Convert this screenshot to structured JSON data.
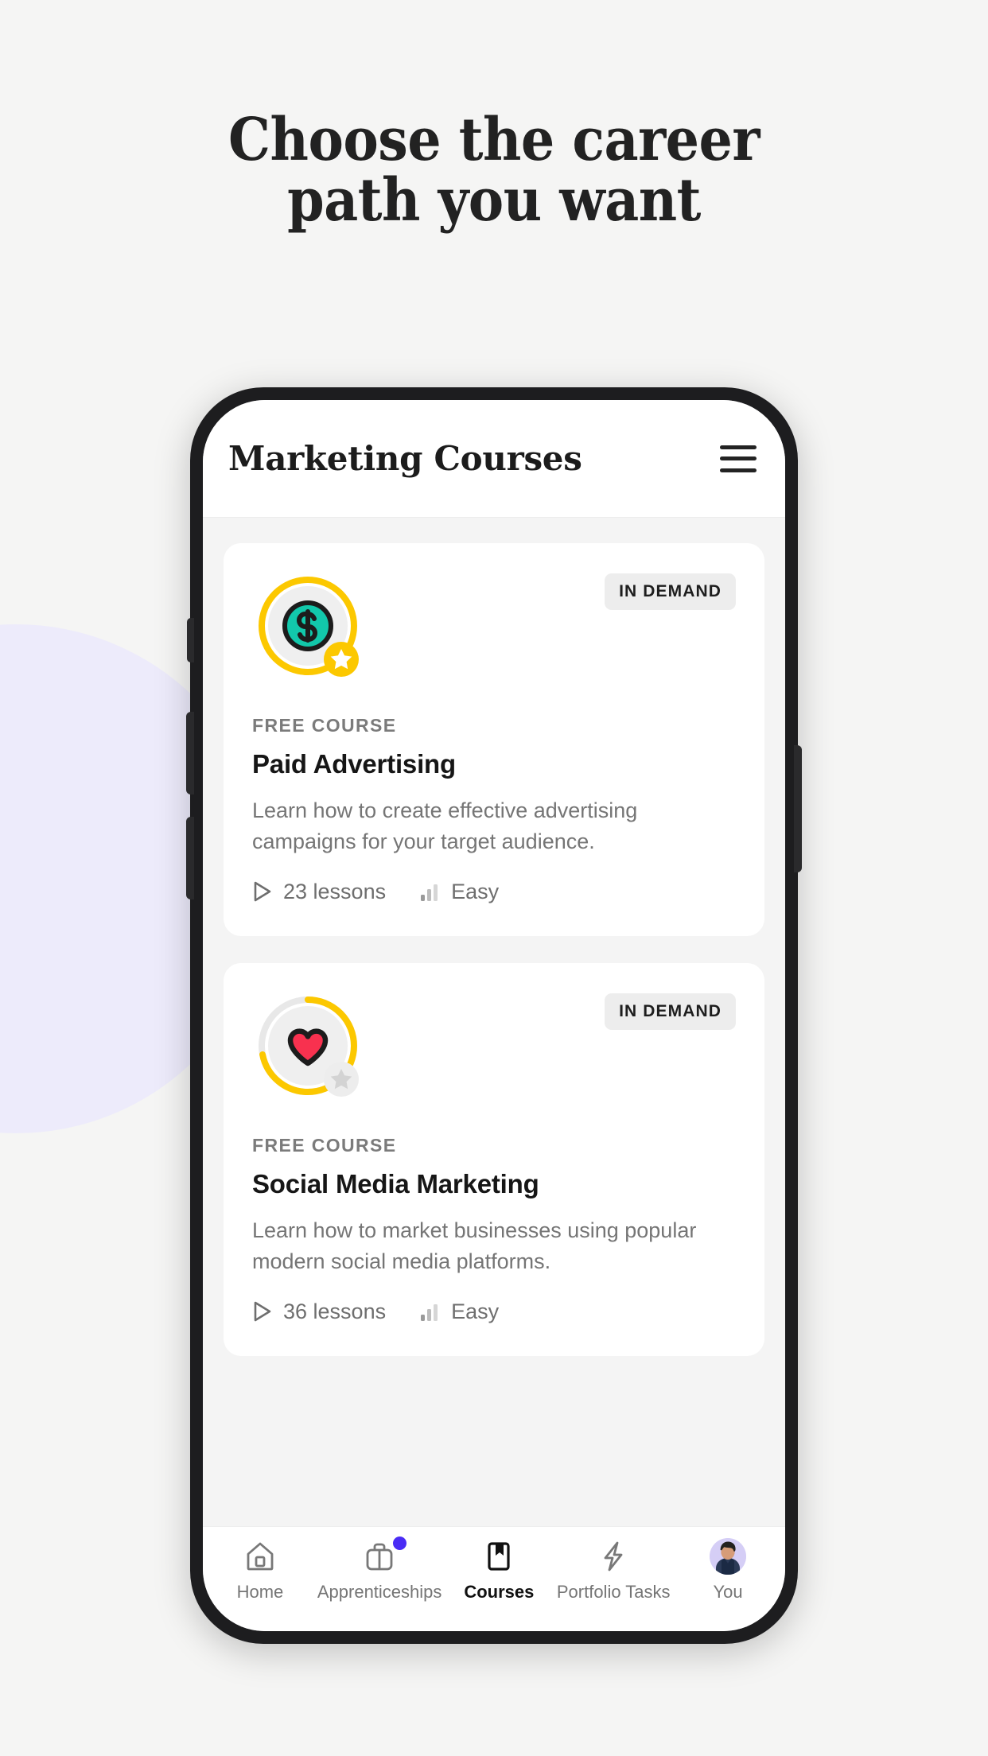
{
  "marketing": {
    "headline_line1": "Choose the career",
    "headline_line2": "path you want"
  },
  "app": {
    "header": {
      "title": "Marketing Courses",
      "menu_icon": "hamburger-menu-icon"
    },
    "colors": {
      "page_background": "#F5F5F4",
      "blob": "#EDEBFB",
      "screen_background": "#F4F4F4",
      "card": "#FFFFFF",
      "accent_yellow": "#FCC800",
      "accent_teal": "#12C8AB",
      "accent_red": "#F8314F",
      "badge_dot_purple": "#4A2CF5",
      "frame": "#1D1D1F"
    },
    "courses": [
      {
        "badge": "IN DEMAND",
        "eyebrow": "FREE COURSE",
        "title": "Paid Advertising",
        "description": "Learn how to create effective advertising campaigns for your target audience.",
        "lessons": "23 lessons",
        "difficulty": "Easy",
        "icon": "dollar-coin-icon",
        "icon_color": "#12C8AB",
        "ring_progress": 100,
        "star_state": "earned"
      },
      {
        "badge": "IN DEMAND",
        "eyebrow": "FREE COURSE",
        "title": "Social Media Marketing",
        "description": "Learn how to market businesses using popular modern social media platforms.",
        "lessons": "36 lessons",
        "difficulty": "Easy",
        "icon": "heart-icon",
        "icon_color": "#F8314F",
        "ring_progress": 72,
        "star_state": "locked"
      }
    ],
    "tabbar": [
      {
        "label": "Home",
        "icon": "home-icon",
        "active": false,
        "badge": false
      },
      {
        "label": "Apprenticeships",
        "icon": "briefcase-icon",
        "active": false,
        "badge": true
      },
      {
        "label": "Courses",
        "icon": "bookmark-icon",
        "active": true,
        "badge": false
      },
      {
        "label": "Portfolio Tasks",
        "icon": "bolt-icon",
        "active": false,
        "badge": false
      },
      {
        "label": "You",
        "icon": "avatar-icon",
        "active": false,
        "badge": false
      }
    ]
  }
}
